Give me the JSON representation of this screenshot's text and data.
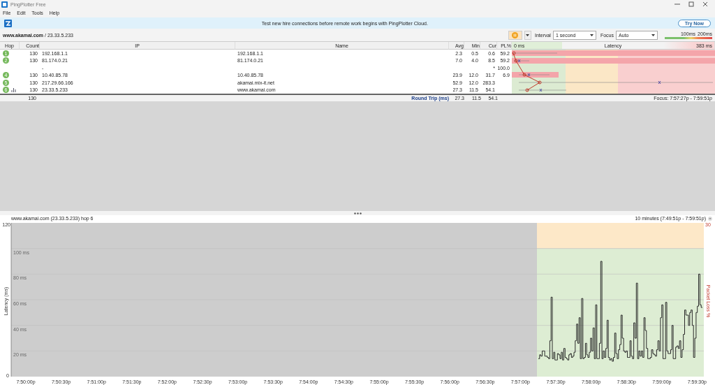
{
  "window": {
    "title": "PingPlotter Free"
  },
  "menu": [
    "File",
    "Edit",
    "Tools",
    "Help"
  ],
  "banner": {
    "text": "Test new hire connections before remote work begins with PingPlotter Cloud.",
    "button": "Try Now"
  },
  "toolbar": {
    "host": "www.akamai.com",
    "address": " / 23.33.5.233",
    "interval_label": "Interval",
    "interval": "1 second",
    "focus_label": "Focus",
    "focus": "Auto",
    "legend": [
      "100ms",
      "200ms"
    ]
  },
  "table": {
    "columns": [
      "Hop",
      "Count",
      "IP",
      "Name",
      "Avg",
      "Min",
      "Cur",
      "PL%"
    ],
    "latency": {
      "title": "Latency",
      "min": "0 ms",
      "max": "383 ms"
    },
    "rows": [
      {
        "kind": "hop",
        "hop": "1",
        "count": "130",
        "ip": "192.168.1.1",
        "name": "192.168.1.1",
        "avg": "2.3",
        "min": "0.5",
        "cur": "0.6",
        "pl": "59.2"
      },
      {
        "kind": "hop",
        "hop": "2",
        "count": "130",
        "ip": "81.174.0.21",
        "name": "81.174.0.21",
        "avg": "7.0",
        "min": "4.0",
        "cur": "8.5",
        "pl": "59.2"
      },
      {
        "kind": "timeout",
        "ip": "-",
        "cur": "*",
        "pl": "100.0"
      },
      {
        "kind": "hop",
        "hop": "4",
        "count": "130",
        "ip": "10.40.85.78",
        "name": "10.40.85.78",
        "avg": "23.9",
        "min": "12.0",
        "cur": "31.7",
        "pl": "6.9"
      },
      {
        "kind": "hop",
        "hop": "5",
        "count": "130",
        "ip": "217.29.66.166",
        "name": "akamai.mix-it.net",
        "avg": "52.9",
        "min": "12.0",
        "cur": "283.3"
      },
      {
        "kind": "graphed",
        "hop": "6",
        "count": "130",
        "ip": "23.33.5.233",
        "name": "www.akamai.com",
        "avg": "27.3",
        "min": "11.5",
        "cur": "54.1"
      }
    ],
    "summary": {
      "count": "130",
      "label": "Round Trip (ms)",
      "avg": "27.3",
      "min": "11.5",
      "cur": "54.1",
      "focus": "Focus: 7:57:27p - 7:59:51p"
    }
  },
  "graph": {
    "title": "www.akamai.com (23.33.5.233) hop 6",
    "range": "10 minutes (7:49:51p - 7:59:51p)",
    "ylabel": "Latency (ms)",
    "y2label": "Packet Loss %",
    "ymax": "120",
    "ymin": "0",
    "y2max": "30",
    "gridlines": [
      "100 ms",
      "80 ms",
      "60 ms",
      "40 ms",
      "20 ms"
    ],
    "xticks": [
      "7:50:00p",
      "7:50:30p",
      "7:51:00p",
      "7:51:30p",
      "7:52:00p",
      "7:52:30p",
      "7:53:00p",
      "7:53:30p",
      "7:54:00p",
      "7:54:30p",
      "7:55:00p",
      "7:55:30p",
      "7:56:00p",
      "7:56:30p",
      "7:57:00p",
      "7:57:30p",
      "7:58:00p",
      "7:58:30p",
      "7:59:00p",
      "7:59:30p"
    ]
  }
}
